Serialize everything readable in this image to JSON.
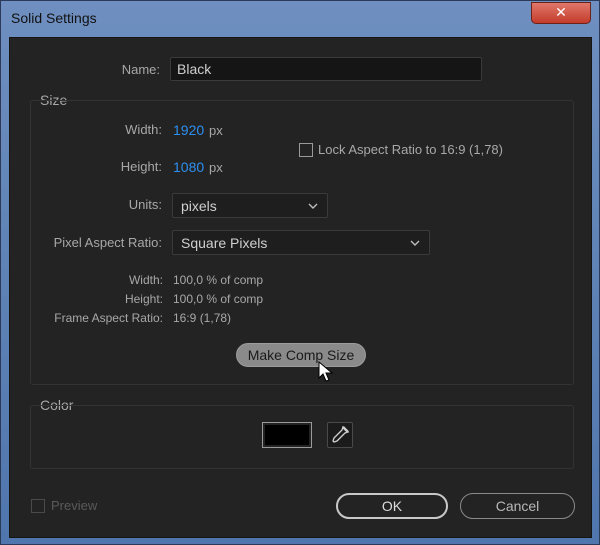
{
  "window": {
    "title": "Solid Settings",
    "close_glyph": "✕"
  },
  "name": {
    "label": "Name:",
    "value": "Black"
  },
  "size": {
    "group_title": "Size",
    "width_label": "Width:",
    "width_value": "1920",
    "width_unit": "px",
    "height_label": "Height:",
    "height_value": "1080",
    "height_unit": "px",
    "lock_label": "Lock Aspect Ratio to 16:9 (1,78)",
    "units_label": "Units:",
    "units_value": "pixels",
    "par_label": "Pixel Aspect Ratio:",
    "par_value": "Square Pixels",
    "info": {
      "width_label": "Width:",
      "width_value": "100,0 % of comp",
      "height_label": "Height:",
      "height_value": "100,0 % of comp",
      "far_label": "Frame Aspect Ratio:",
      "far_value": "16:9 (1,78)"
    },
    "make_comp_size": "Make Comp Size"
  },
  "color": {
    "group_title": "Color",
    "swatch_color": "#000000"
  },
  "footer": {
    "preview_label": "Preview",
    "ok_label": "OK",
    "cancel_label": "Cancel"
  },
  "icons": [
    "close-icon",
    "chevron-down-icon",
    "eyedropper-icon",
    "cursor-icon"
  ]
}
